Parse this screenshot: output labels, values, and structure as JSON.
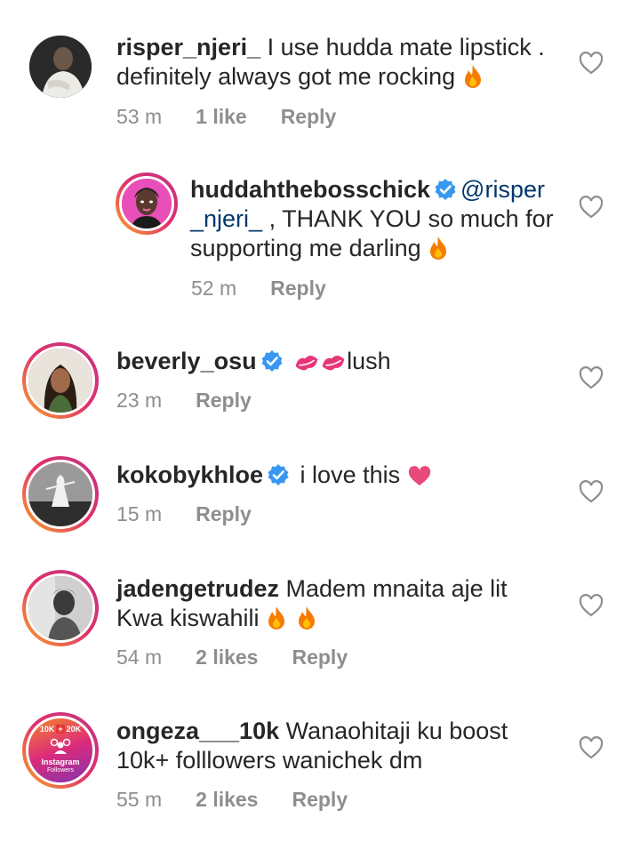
{
  "comments": [
    {
      "username": "risper_njeri_",
      "text": " I use hudda mate lipstick .",
      "text2": "definitely always got me rocking ",
      "time": "53 m",
      "likes": "1 like",
      "reply": "Reply"
    },
    {
      "username": "huddahthebosschick",
      "mention1": "@risper",
      "mention2": "_njeri_",
      "text": " , THANK YOU so much for",
      "text2": "supporting me darling ",
      "time": "52 m",
      "reply": "Reply"
    },
    {
      "username": "beverly_osu",
      "text": "lush",
      "time": "23 m",
      "reply": "Reply"
    },
    {
      "username": "kokobykhloe",
      "text": " i love this ",
      "time": "15 m",
      "reply": "Reply"
    },
    {
      "username": "jadengetrudez",
      "text": " Madem mnaita aje lit",
      "text2": "Kwa kiswahili ",
      "time": "54 m",
      "likes": "2 likes",
      "reply": "Reply"
    },
    {
      "username": "ongeza___10k",
      "text": " Wanaohitaji ku boost",
      "text2": "10k+ folllowers wanichek  dm",
      "time": "55 m",
      "likes": "2 likes",
      "reply": "Reply",
      "avatar_text": {
        "left": "10K",
        "right": "20K",
        "line1": "Instagram",
        "line2": "Followers"
      }
    }
  ],
  "icons": {
    "like": "heart-outline-icon",
    "verified": "verified-badge-icon",
    "fire": "fire-emoji-icon",
    "kiss": "kiss-mark-emoji-icon",
    "pink_heart": "heart-emoji-icon"
  },
  "colors": {
    "verified": "#3897f0",
    "meta": "#8e8e8e",
    "text": "#262626",
    "fire": "#f57c00"
  }
}
